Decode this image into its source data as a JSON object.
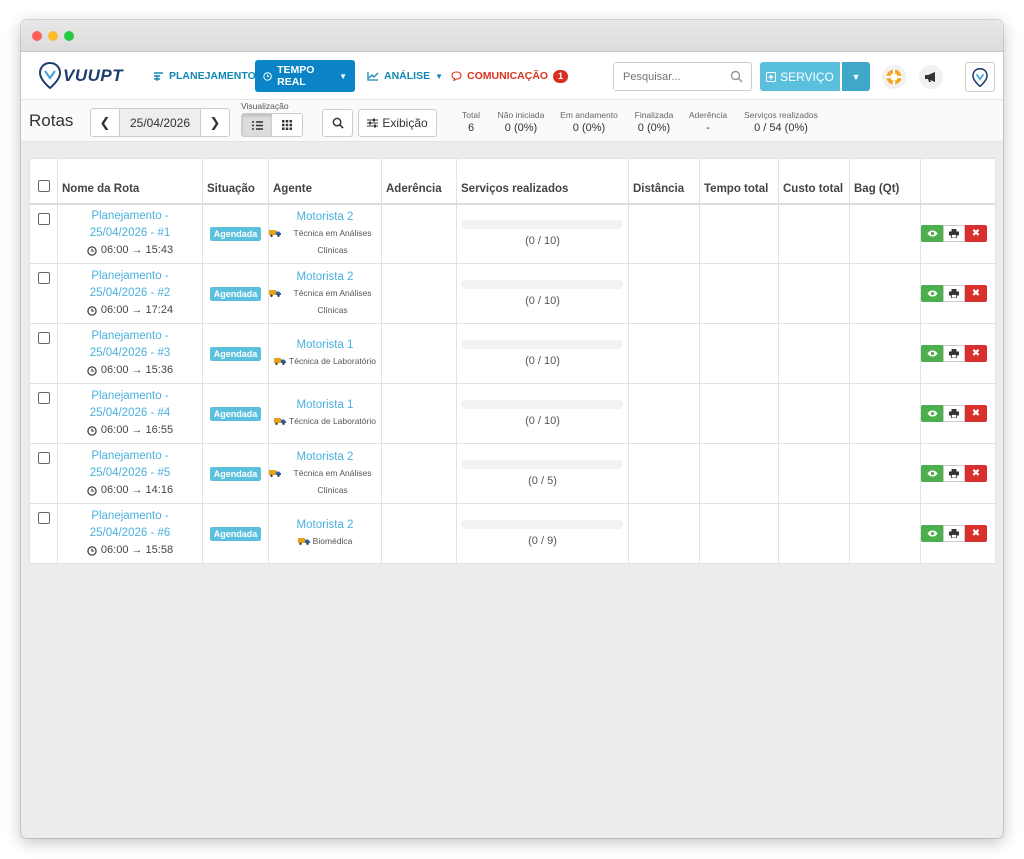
{
  "nav": {
    "logo": "VUUPT",
    "items": [
      {
        "label": "PLANEJAMENTO"
      },
      {
        "label": "TEMPO REAL"
      },
      {
        "label": "ANÁLISE"
      },
      {
        "label": "COMUNICAÇÃO"
      }
    ],
    "comm_badge": "1",
    "search_placeholder": "Pesquisar...",
    "service_button": "SERVIÇO"
  },
  "toolbar": {
    "title": "Rotas",
    "date": "25/04/2026",
    "view_label": "Visualização",
    "display_button": "Exibição",
    "stats": [
      {
        "label": "Total",
        "value": "6"
      },
      {
        "label": "Não iniciada",
        "value": "0 (0%)"
      },
      {
        "label": "Em andamento",
        "value": "0 (0%)"
      },
      {
        "label": "Finalizada",
        "value": "0 (0%)"
      },
      {
        "label": "Aderência",
        "value": "-"
      },
      {
        "label": "Serviços realizados",
        "value": "0 / 54 (0%)"
      }
    ]
  },
  "table": {
    "headers": [
      "Nome da Rota",
      "Situação",
      "Agente",
      "Aderência",
      "Serviços realizados",
      "Distância",
      "Tempo total",
      "Custo total",
      "Bag (Qt)"
    ],
    "rows": [
      {
        "name1": "Planejamento -",
        "name2": "25/04/2026 - #1",
        "time": "06:00 → 15:43",
        "status": "Agendada",
        "agent": "Motorista 2",
        "role": "Técnica em Análises Clínicas",
        "services": "(0 / 10)",
        "progress": 0
      },
      {
        "name1": "Planejamento -",
        "name2": "25/04/2026 - #2",
        "time": "06:00 → 17:24",
        "status": "Agendada",
        "agent": "Motorista 2",
        "role": "Técnica em Análises Clínicas",
        "services": "(0 / 10)",
        "progress": 0
      },
      {
        "name1": "Planejamento -",
        "name2": "25/04/2026 - #3",
        "time": "06:00 → 15:36",
        "status": "Agendada",
        "agent": "Motorista 1",
        "role": "Técnica de Laboratório",
        "services": "(0 / 10)",
        "progress": 0
      },
      {
        "name1": "Planejamento -",
        "name2": "25/04/2026 - #4",
        "time": "06:00 → 16:55",
        "status": "Agendada",
        "agent": "Motorista 1",
        "role": "Técnica de Laboratório",
        "services": "(0 / 10)",
        "progress": 0
      },
      {
        "name1": "Planejamento -",
        "name2": "25/04/2026 - #5",
        "time": "06:00 → 14:16",
        "status": "Agendada",
        "agent": "Motorista 2",
        "role": "Técnica em Análises Clínicas",
        "services": "(0 / 5)",
        "progress": 0
      },
      {
        "name1": "Planejamento -",
        "name2": "25/04/2026 - #6",
        "time": "06:00 → 15:58",
        "status": "Agendada",
        "agent": "Motorista 2",
        "role": "Biomédica",
        "services": "(0 / 9)",
        "progress": 0
      }
    ]
  },
  "colors": {
    "accent": "#0a84c6",
    "link": "#4ab0dd",
    "status_tag": "#5bc0de",
    "view_btn": "#4cae4c",
    "delete_btn": "#d9302d"
  }
}
